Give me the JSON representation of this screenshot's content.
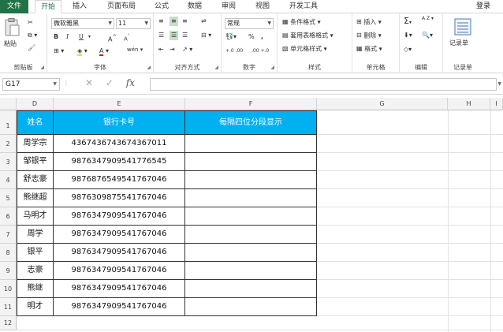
{
  "menubar": {
    "file_label": "文件",
    "tabs": [
      "开始",
      "插入",
      "页面布局",
      "公式",
      "数据",
      "审阅",
      "视图",
      "开发工具"
    ],
    "active_tab": "开始",
    "login_label": "登录"
  },
  "ribbon": {
    "clipboard": {
      "paste_label": "粘贴",
      "group_label": "剪贴板"
    },
    "font": {
      "font_name": "微软雅黑",
      "font_size": "11",
      "bold": "B",
      "italic": "I",
      "underline": "U",
      "grow": "A",
      "shrink": "A",
      "group_label": "字体",
      "wen": "wén"
    },
    "alignment": {
      "group_label": "对齐方式"
    },
    "number": {
      "format": "常规",
      "percent": "%",
      "comma": ",",
      "group_label": "数字",
      "inc": "+.0 .00",
      "dec": ".00 +.0"
    },
    "styles": {
      "conditional": "条件格式",
      "table": "套用表格格式",
      "cell": "单元格样式",
      "group_label": "样式"
    },
    "cells": {
      "insert": "插入",
      "delete": "删除",
      "format": "格式",
      "group_label": "单元格"
    },
    "editing": {
      "sum": "Σ",
      "sort": "A Z",
      "group_label": "编辑"
    },
    "notes": {
      "label": "记录单",
      "group_label": "记录单"
    }
  },
  "formula_bar": {
    "name_box": "G17",
    "fx": "fx",
    "cancel": "✕",
    "confirm": "✓",
    "formula": ""
  },
  "sheet": {
    "columns": [
      "D",
      "E",
      "F",
      "G",
      "H",
      "I"
    ],
    "rows": [
      "1",
      "2",
      "3",
      "4",
      "5",
      "6",
      "7",
      "8",
      "9",
      "10",
      "11",
      "12"
    ],
    "headers": [
      "姓名",
      "银行卡号",
      "每隔四位分段显示"
    ],
    "data": [
      [
        "周学宗",
        "4367436743674367011",
        ""
      ],
      [
        "邹银平",
        "9876347909541776545",
        ""
      ],
      [
        "舒志豪",
        "9876876549541767046",
        ""
      ],
      [
        "熊继超",
        "9876309875541767046",
        ""
      ],
      [
        "马明才",
        "9876347909541767046",
        ""
      ],
      [
        "周学",
        "9876347909541767046",
        ""
      ],
      [
        "银平",
        "9876347909541767046",
        ""
      ],
      [
        "志豪",
        "9876347909541767046",
        ""
      ],
      [
        "熊继",
        "9876347909541767046",
        ""
      ],
      [
        "明才",
        "9876347909541767046",
        ""
      ]
    ],
    "header_color": "#00b0f0",
    "accent_color": "#217346"
  }
}
